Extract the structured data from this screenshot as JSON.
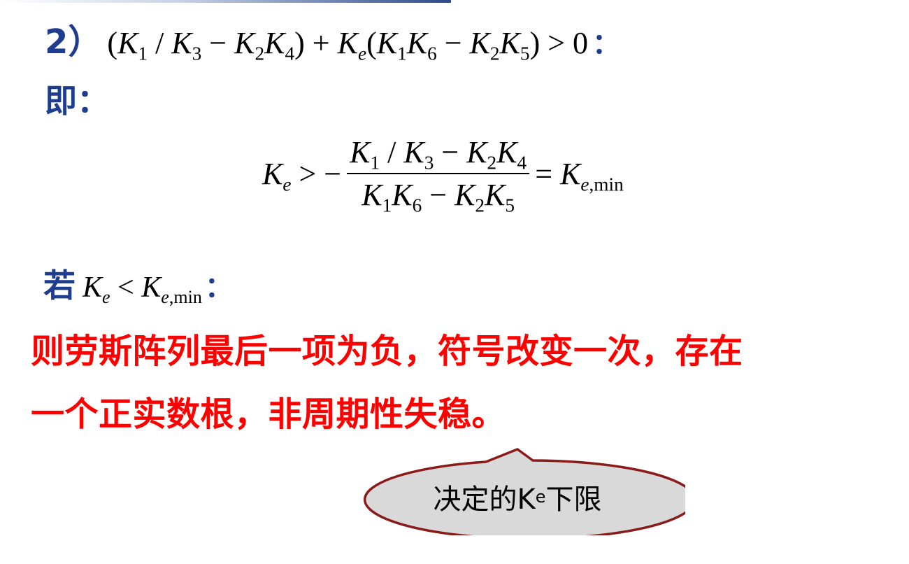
{
  "line1": {
    "label": "2）",
    "colon": "："
  },
  "line2": {
    "text": "即："
  },
  "line3": {
    "label": "若",
    "colon": "："
  },
  "statement": {
    "line1": "则劳斯阵列最后一项为负，符号改变一次，存在",
    "line2": "一个正实数根，非周期性失稳。"
  },
  "callout": {
    "text_before": "决定的K",
    "subscript": "e",
    "text_after": "下限",
    "fill": "#d9d9d9",
    "stroke": "#8b1a1a"
  },
  "colors": {
    "heading_blue": "#1f3d8f",
    "emphasis_red": "#ff0000"
  }
}
